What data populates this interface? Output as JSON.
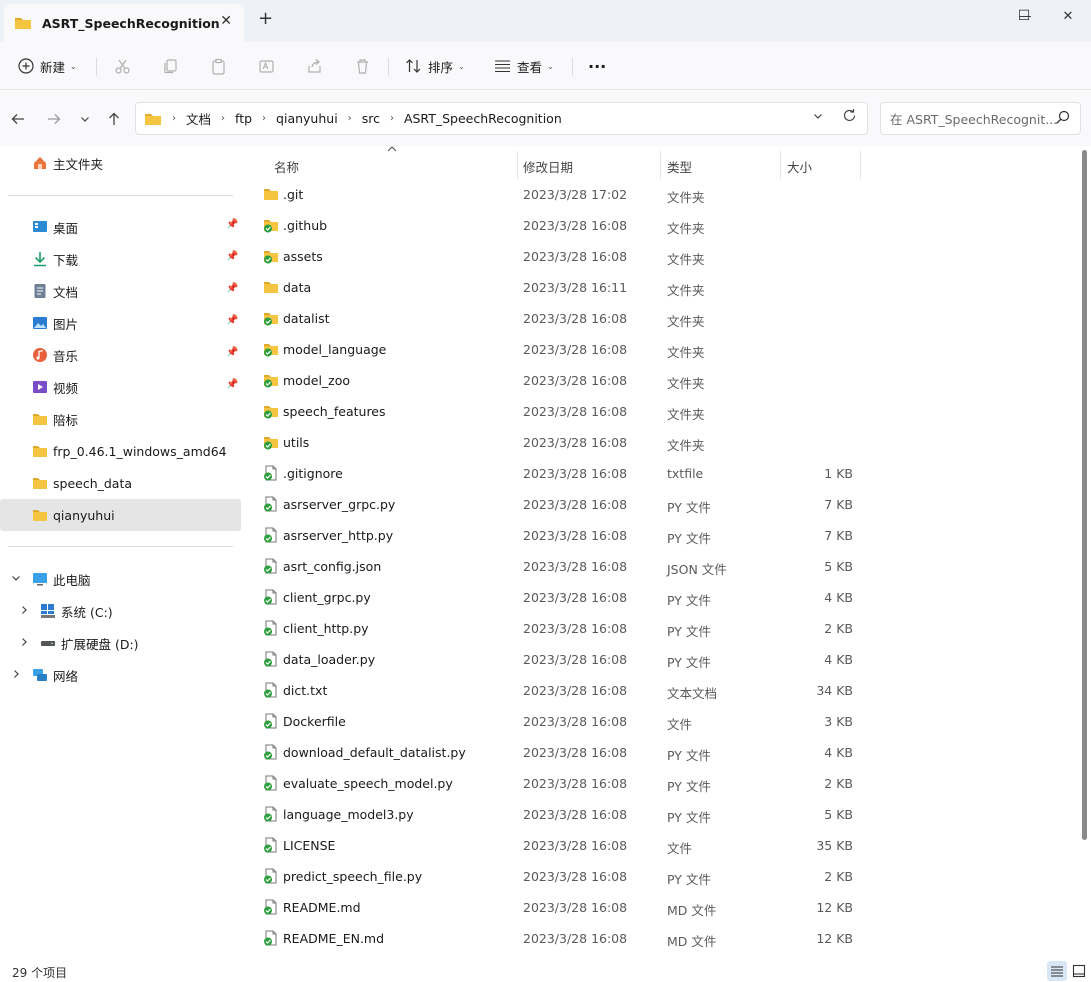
{
  "tab": {
    "title": "ASRT_SpeechRecognition",
    "close": "✕",
    "new_tab": "+"
  },
  "window_controls": {
    "minimize": "—",
    "maximize": "☐",
    "close": "✕"
  },
  "toolbar": {
    "new_label": "新建",
    "sort_label": "排序",
    "view_label": "查看",
    "more": "···"
  },
  "breadcrumb": [
    "文档",
    "ftp",
    "qianyuhui",
    "src",
    "ASRT_SpeechRecognition"
  ],
  "search": {
    "placeholder": "在 ASRT_SpeechRecognit..."
  },
  "sidebar": {
    "home": "主文件夹",
    "quick": [
      {
        "label": "桌面",
        "icon": "desktop-icon"
      },
      {
        "label": "下载",
        "icon": "download-icon"
      },
      {
        "label": "文档",
        "icon": "document-icon"
      },
      {
        "label": "图片",
        "icon": "pictures-icon"
      },
      {
        "label": "音乐",
        "icon": "music-icon"
      },
      {
        "label": "视频",
        "icon": "video-icon"
      }
    ],
    "folders": [
      "陪标",
      "frp_0.46.1_windows_amd64",
      "speech_data",
      "qianyuhui"
    ],
    "this_pc": "此电脑",
    "drives": [
      "系统 (C:)",
      "扩展硬盘 (D:)"
    ],
    "network": "网络"
  },
  "columns": {
    "name": "名称",
    "date": "修改日期",
    "type": "类型",
    "size": "大小"
  },
  "files": [
    {
      "name": ".git",
      "date": "2023/3/28 17:02",
      "type": "文件夹",
      "size": "",
      "kind": "folder"
    },
    {
      "name": ".github",
      "date": "2023/3/28 16:08",
      "type": "文件夹",
      "size": "",
      "kind": "folder-synced"
    },
    {
      "name": "assets",
      "date": "2023/3/28 16:08",
      "type": "文件夹",
      "size": "",
      "kind": "folder-synced"
    },
    {
      "name": "data",
      "date": "2023/3/28 16:11",
      "type": "文件夹",
      "size": "",
      "kind": "folder"
    },
    {
      "name": "datalist",
      "date": "2023/3/28 16:08",
      "type": "文件夹",
      "size": "",
      "kind": "folder-synced"
    },
    {
      "name": "model_language",
      "date": "2023/3/28 16:08",
      "type": "文件夹",
      "size": "",
      "kind": "folder-synced"
    },
    {
      "name": "model_zoo",
      "date": "2023/3/28 16:08",
      "type": "文件夹",
      "size": "",
      "kind": "folder-synced"
    },
    {
      "name": "speech_features",
      "date": "2023/3/28 16:08",
      "type": "文件夹",
      "size": "",
      "kind": "folder-synced"
    },
    {
      "name": "utils",
      "date": "2023/3/28 16:08",
      "type": "文件夹",
      "size": "",
      "kind": "folder-synced"
    },
    {
      "name": ".gitignore",
      "date": "2023/3/28 16:08",
      "type": "txtfile",
      "size": "1 KB",
      "kind": "file"
    },
    {
      "name": "asrserver_grpc.py",
      "date": "2023/3/28 16:08",
      "type": "PY 文件",
      "size": "7 KB",
      "kind": "file"
    },
    {
      "name": "asrserver_http.py",
      "date": "2023/3/28 16:08",
      "type": "PY 文件",
      "size": "7 KB",
      "kind": "file"
    },
    {
      "name": "asrt_config.json",
      "date": "2023/3/28 16:08",
      "type": "JSON 文件",
      "size": "5 KB",
      "kind": "file"
    },
    {
      "name": "client_grpc.py",
      "date": "2023/3/28 16:08",
      "type": "PY 文件",
      "size": "4 KB",
      "kind": "file"
    },
    {
      "name": "client_http.py",
      "date": "2023/3/28 16:08",
      "type": "PY 文件",
      "size": "2 KB",
      "kind": "file"
    },
    {
      "name": "data_loader.py",
      "date": "2023/3/28 16:08",
      "type": "PY 文件",
      "size": "4 KB",
      "kind": "file"
    },
    {
      "name": "dict.txt",
      "date": "2023/3/28 16:08",
      "type": "文本文档",
      "size": "34 KB",
      "kind": "file"
    },
    {
      "name": "Dockerfile",
      "date": "2023/3/28 16:08",
      "type": "文件",
      "size": "3 KB",
      "kind": "file"
    },
    {
      "name": "download_default_datalist.py",
      "date": "2023/3/28 16:08",
      "type": "PY 文件",
      "size": "4 KB",
      "kind": "file"
    },
    {
      "name": "evaluate_speech_model.py",
      "date": "2023/3/28 16:08",
      "type": "PY 文件",
      "size": "2 KB",
      "kind": "file"
    },
    {
      "name": "language_model3.py",
      "date": "2023/3/28 16:08",
      "type": "PY 文件",
      "size": "5 KB",
      "kind": "file"
    },
    {
      "name": "LICENSE",
      "date": "2023/3/28 16:08",
      "type": "文件",
      "size": "35 KB",
      "kind": "file"
    },
    {
      "name": "predict_speech_file.py",
      "date": "2023/3/28 16:08",
      "type": "PY 文件",
      "size": "2 KB",
      "kind": "file"
    },
    {
      "name": "README.md",
      "date": "2023/3/28 16:08",
      "type": "MD 文件",
      "size": "12 KB",
      "kind": "file"
    },
    {
      "name": "README_EN.md",
      "date": "2023/3/28 16:08",
      "type": "MD 文件",
      "size": "12 KB",
      "kind": "file"
    }
  ],
  "status": {
    "count": "29 个项目"
  },
  "colors": {
    "folder": "#f5c542",
    "folder_dark": "#e0a92b",
    "sync_green": "#2e9e3e",
    "selected_bg": "#e5e5e5",
    "accent": "#0067c0"
  }
}
